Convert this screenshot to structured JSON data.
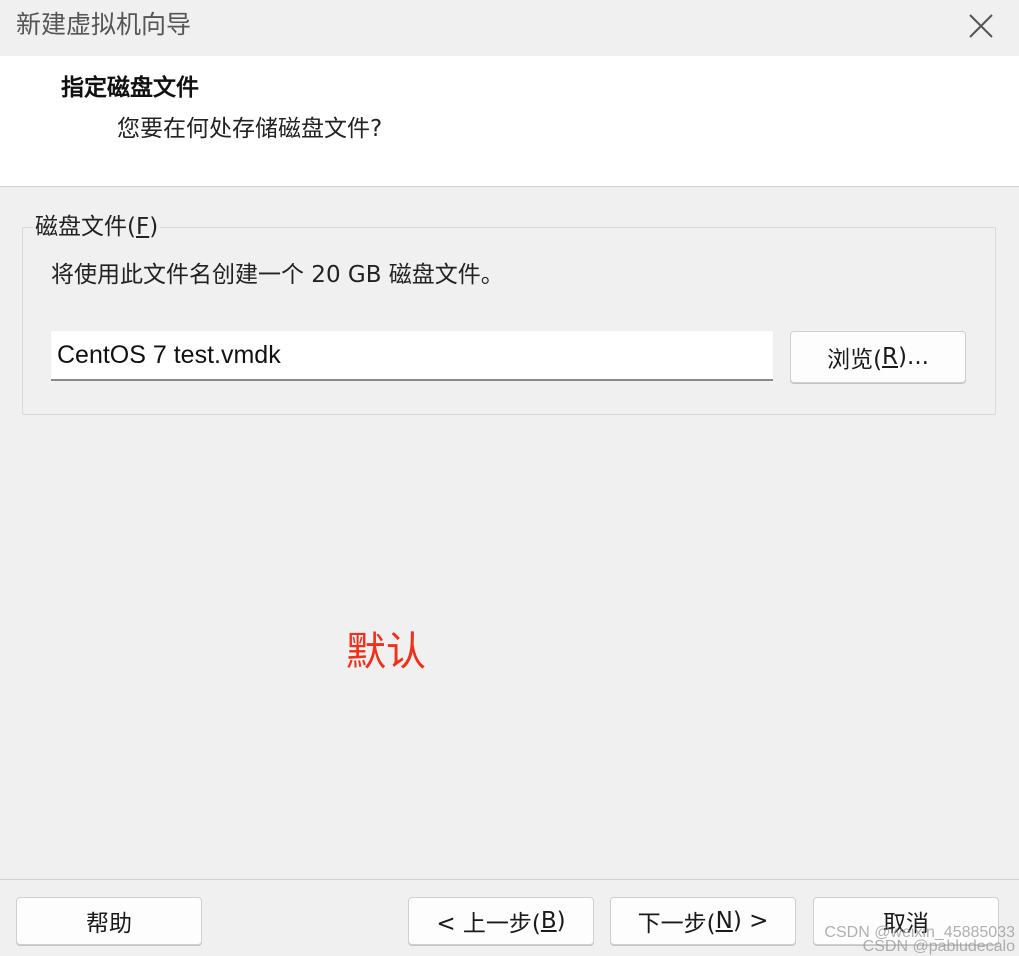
{
  "window": {
    "title": "新建虚拟机向导"
  },
  "header": {
    "title": "指定磁盘文件",
    "subtitle": "您要在何处存储磁盘文件?"
  },
  "disk_file": {
    "legend_text": "磁盘文件(",
    "legend_key": "F",
    "legend_end": ")",
    "description": "将使用此文件名创建一个 20 GB 磁盘文件。",
    "filename": "CentOS 7 test.vmdk",
    "browse_text": "浏览(",
    "browse_key": "R",
    "browse_end": ")..."
  },
  "annotation": {
    "text": "默认",
    "color": "#f0301a"
  },
  "footer": {
    "help_label": "帮助",
    "back_text": "< 上一步(",
    "back_key": "B",
    "back_end": ")",
    "next_text": "下一步(",
    "next_key": "N",
    "next_end": ") >",
    "cancel_label": "取消"
  },
  "watermark": {
    "line1": "CSDN @weixin_45885033",
    "line2": "CSDN @pabludecalo"
  }
}
